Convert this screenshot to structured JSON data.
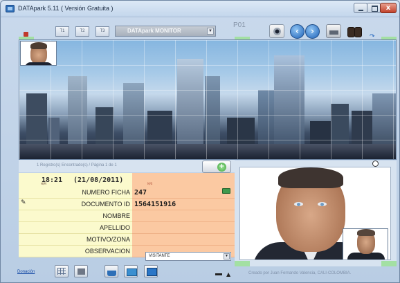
{
  "window": {
    "title": "DATApark 5.11  ( Versión Gratuita )",
    "close_label": "x"
  },
  "toolbar": {
    "tabs": [
      "T1",
      "T2",
      "T3"
    ],
    "monitor_select": "DATApark MONITOR",
    "station": "P01",
    "icons": [
      "camera-icon",
      "nav-left-icon",
      "nav-right-icon",
      "printer-icon",
      "binoculars-icon",
      "refresh-icon"
    ]
  },
  "records": {
    "status": "1 Registro(s) Encontrado(s) / Página 1 de 1"
  },
  "clock": {
    "time": "18:21",
    "date": "(21/08/2011)",
    "hm_label": "H/M",
    "ms_label": "M/S"
  },
  "form": {
    "rows": [
      {
        "label": "NUMERO FICHA",
        "value": "247"
      },
      {
        "label": "DOCUMENTO ID",
        "value": "1564151916"
      },
      {
        "label": "NOMBRE",
        "value": ""
      },
      {
        "label": "APELLIDO",
        "value": ""
      },
      {
        "label": "MOTIVO/ZONA",
        "value": ""
      },
      {
        "label": "OBSERVACION",
        "value": ""
      }
    ],
    "visitor_type": "VISITANTE"
  },
  "footer": {
    "donation_link": "Donación",
    "credit": "Creado por Juan Fernando Valencia, CALI-COLOMBIA."
  },
  "colors": {
    "label_bg": "#fbfacd",
    "value_bg": "#fbc9a2",
    "green_marker": "#a3e0a3",
    "accent_blue": "#1f62b8"
  }
}
